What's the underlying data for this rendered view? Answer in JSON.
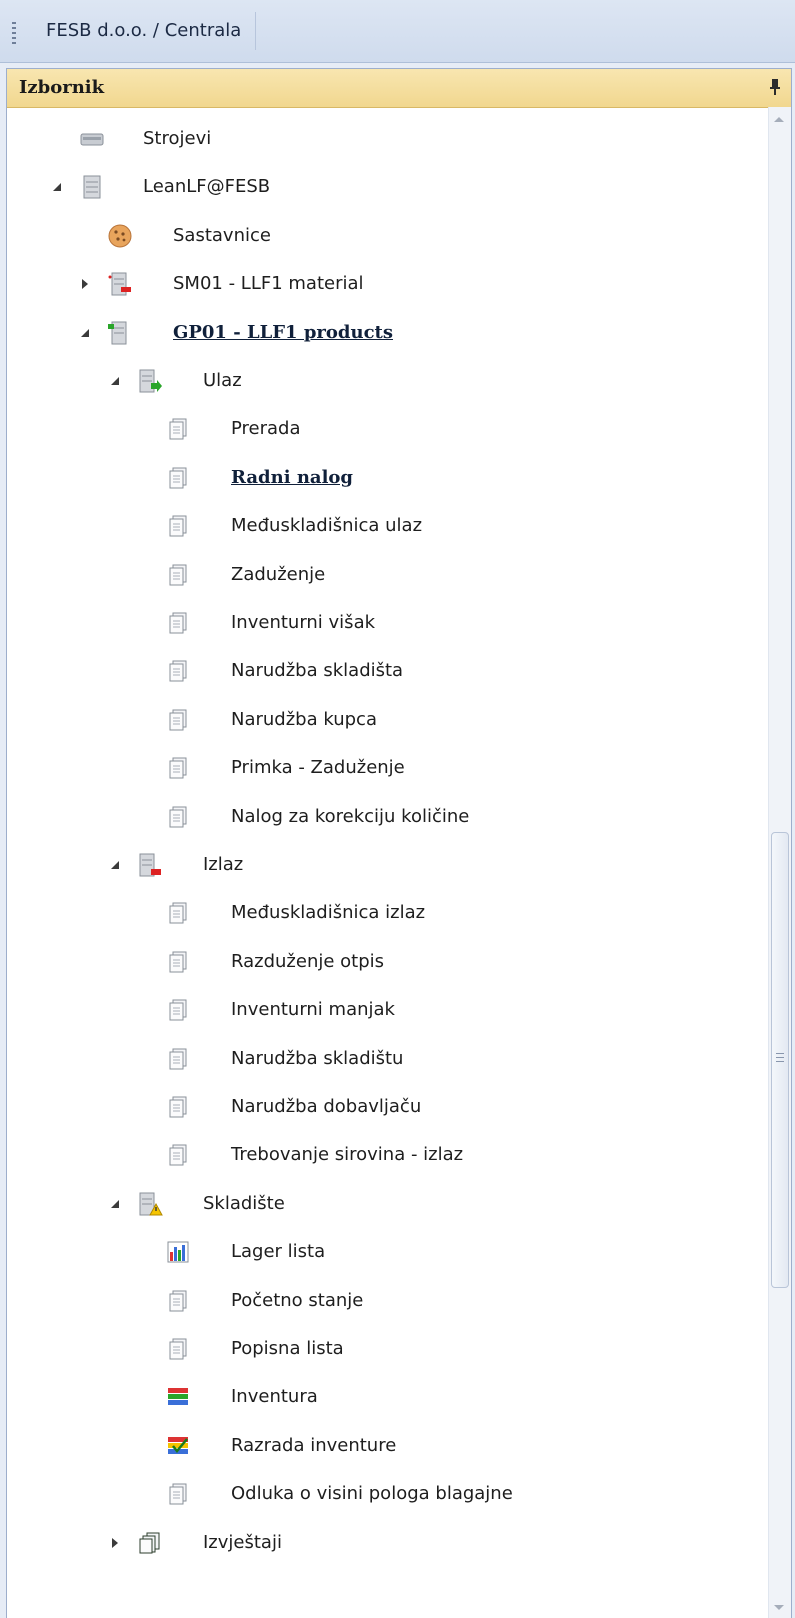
{
  "window": {
    "title": "FESB d.o.o. / Centrala"
  },
  "panel": {
    "title": "Izbornik"
  },
  "tree": [
    {
      "label": "Strojevi",
      "icon": "machine-icon",
      "arrow": null,
      "level": 0
    },
    {
      "label": "LeanLF@FESB",
      "icon": "server-icon",
      "arrow": "expanded",
      "level": 0
    },
    {
      "label": "Sastavnice",
      "icon": "cookie-icon",
      "arrow": null,
      "level": 1
    },
    {
      "label": "SM01 - LLF1 material",
      "icon": "warehouse-red-icon",
      "arrow": "collapsed",
      "level": 1
    },
    {
      "label": "GP01 - LLF1 products",
      "icon": "warehouse-green-icon",
      "arrow": "expanded",
      "level": 1,
      "bold": true
    },
    {
      "label": "Ulaz",
      "icon": "input-icon",
      "arrow": "expanded",
      "level": 2
    },
    {
      "label": "Prerada",
      "icon": "document-icon",
      "arrow": null,
      "level": 3
    },
    {
      "label": "Radni nalog",
      "icon": "document-icon",
      "arrow": null,
      "level": 3,
      "bold": true
    },
    {
      "label": "Međuskladišnica ulaz",
      "icon": "document-icon",
      "arrow": null,
      "level": 3
    },
    {
      "label": "Zaduženje",
      "icon": "document-icon",
      "arrow": null,
      "level": 3
    },
    {
      "label": "Inventurni višak",
      "icon": "document-icon",
      "arrow": null,
      "level": 3
    },
    {
      "label": "Narudžba skladišta",
      "icon": "document-icon",
      "arrow": null,
      "level": 3
    },
    {
      "label": "Narudžba kupca",
      "icon": "document-icon",
      "arrow": null,
      "level": 3
    },
    {
      "label": "Primka - Zaduženje",
      "icon": "document-icon",
      "arrow": null,
      "level": 3
    },
    {
      "label": "Nalog za korekciju količine",
      "icon": "document-icon",
      "arrow": null,
      "level": 3
    },
    {
      "label": "Izlaz",
      "icon": "output-icon",
      "arrow": "expanded",
      "level": 2
    },
    {
      "label": "Međuskladišnica izlaz",
      "icon": "document-icon",
      "arrow": null,
      "level": 3
    },
    {
      "label": "Razduženje otpis",
      "icon": "document-icon",
      "arrow": null,
      "level": 3
    },
    {
      "label": "Inventurni manjak",
      "icon": "document-icon",
      "arrow": null,
      "level": 3
    },
    {
      "label": "Narudžba skladištu",
      "icon": "document-icon",
      "arrow": null,
      "level": 3
    },
    {
      "label": "Narudžba dobavljaču",
      "icon": "document-icon",
      "arrow": null,
      "level": 3
    },
    {
      "label": "Trebovanje sirovina - izlaz",
      "icon": "document-icon",
      "arrow": null,
      "level": 3
    },
    {
      "label": "Skladište",
      "icon": "warehouse-warning-icon",
      "arrow": "expanded",
      "level": 2
    },
    {
      "label": "Lager lista",
      "icon": "bar-chart-icon",
      "arrow": null,
      "level": 3
    },
    {
      "label": "Početno stanje",
      "icon": "document-icon",
      "arrow": null,
      "level": 3
    },
    {
      "label": "Popisna lista",
      "icon": "document-icon",
      "arrow": null,
      "level": 3
    },
    {
      "label": "Inventura",
      "icon": "stacked-list-icon",
      "arrow": null,
      "level": 3
    },
    {
      "label": "Razrada inventure",
      "icon": "checklist-icon",
      "arrow": null,
      "level": 3
    },
    {
      "label": "Odluka o visini pologa blagajne",
      "icon": "document-icon",
      "arrow": null,
      "level": 3
    },
    {
      "label": "Izvještaji",
      "icon": "reports-icon",
      "arrow": "collapsed",
      "level": 2
    }
  ]
}
